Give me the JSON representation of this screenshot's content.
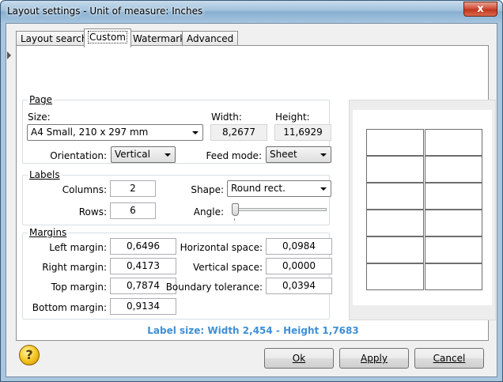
{
  "window": {
    "title": "Layout settings - Unit of measure: Inches",
    "close_label": "x"
  },
  "tabs": [
    {
      "label": "Layout search"
    },
    {
      "label": "Custom"
    },
    {
      "label": "Watermark"
    },
    {
      "label": "Advanced"
    }
  ],
  "page": {
    "legend": "Page",
    "size_label": "Size:",
    "size_value": "A4 Small, 210 x 297 mm",
    "width_label": "Width:",
    "width_value": "8,2677",
    "height_label": "Height:",
    "height_value": "11,6929",
    "orientation_label": "Orientation:",
    "orientation_value": "Vertical",
    "feed_label": "Feed mode:",
    "feed_value": "Sheet"
  },
  "labels": {
    "legend": "Labels",
    "columns_label": "Columns:",
    "columns_value": "2",
    "rows_label": "Rows:",
    "rows_value": "6",
    "shape_label": "Shape:",
    "shape_value": "Round rect.",
    "angle_label": "Angle:",
    "angle_level": 0
  },
  "margins": {
    "legend": "Margins",
    "left_label": "Left margin:",
    "left_value": "0,6496",
    "right_label": "Right margin:",
    "right_value": "0,4173",
    "top_label": "Top margin:",
    "top_value": "0,7874",
    "bottom_label": "Bottom margin:",
    "bottom_value": "0,9134",
    "hspace_label": "Horizontal space:",
    "hspace_value": "0,0984",
    "vspace_label": "Vertical space:",
    "vspace_value": "0,0000",
    "tolerance_label": "Boundary tolerance:",
    "tolerance_value": "0,0394"
  },
  "preview": {
    "columns": 2,
    "rows": 6
  },
  "summary": "Label size: Width 2,454 - Height 1,7683",
  "buttons": {
    "ok": "Ok",
    "apply": "Apply",
    "cancel": "Cancel",
    "help": "?"
  },
  "colors": {
    "summary_text": "#3e8fd6",
    "titlebar": "#9fc0dc",
    "close_button": "#c0361e"
  }
}
